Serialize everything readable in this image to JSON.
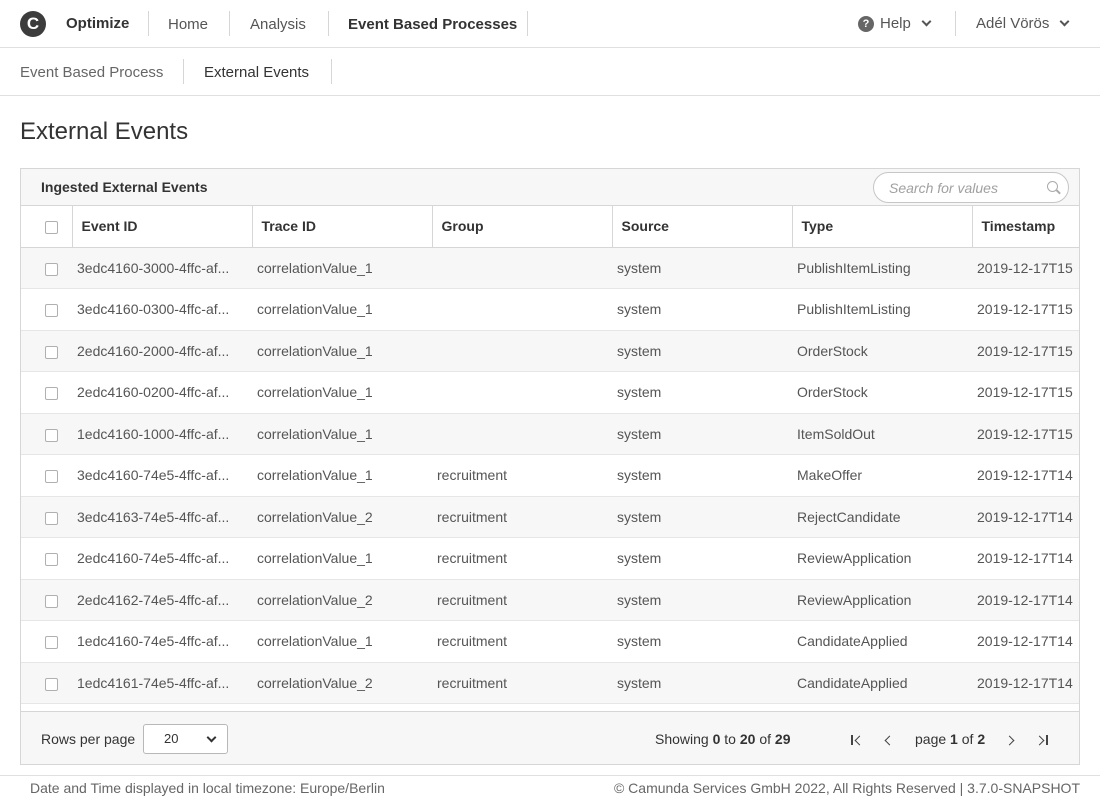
{
  "header": {
    "logo_letter": "C",
    "app_name": "Optimize",
    "nav": [
      "Home",
      "Analysis",
      "Event Based Processes"
    ],
    "help_label": "Help",
    "help_glyph": "?",
    "user_name": "Adél Vörös"
  },
  "subnav": [
    "Event Based Process",
    "External Events"
  ],
  "page_title": "External Events",
  "panel": {
    "title": "Ingested External Events",
    "search_placeholder": "Search for values"
  },
  "table": {
    "columns": [
      "Event ID",
      "Trace ID",
      "Group",
      "Source",
      "Type",
      "Timestamp"
    ],
    "rows": [
      [
        "3edc4160-3000-4ffc-af...",
        "correlationValue_1",
        "",
        "system",
        "PublishItemListing",
        "2019-12-17T15"
      ],
      [
        "3edc4160-0300-4ffc-af...",
        "correlationValue_1",
        "",
        "system",
        "PublishItemListing",
        "2019-12-17T15"
      ],
      [
        "2edc4160-2000-4ffc-af...",
        "correlationValue_1",
        "",
        "system",
        "OrderStock",
        "2019-12-17T15"
      ],
      [
        "2edc4160-0200-4ffc-af...",
        "correlationValue_1",
        "",
        "system",
        "OrderStock",
        "2019-12-17T15"
      ],
      [
        "1edc4160-1000-4ffc-af...",
        "correlationValue_1",
        "",
        "system",
        "ItemSoldOut",
        "2019-12-17T15"
      ],
      [
        "3edc4160-74e5-4ffc-af...",
        "correlationValue_1",
        "recruitment",
        "system",
        "MakeOffer",
        "2019-12-17T14"
      ],
      [
        "3edc4163-74e5-4ffc-af...",
        "correlationValue_2",
        "recruitment",
        "system",
        "RejectCandidate",
        "2019-12-17T14"
      ],
      [
        "2edc4160-74e5-4ffc-af...",
        "correlationValue_1",
        "recruitment",
        "system",
        "ReviewApplication",
        "2019-12-17T14"
      ],
      [
        "2edc4162-74e5-4ffc-af...",
        "correlationValue_2",
        "recruitment",
        "system",
        "ReviewApplication",
        "2019-12-17T14"
      ],
      [
        "1edc4160-74e5-4ffc-af...",
        "correlationValue_1",
        "recruitment",
        "system",
        "CandidateApplied",
        "2019-12-17T14"
      ],
      [
        "1edc4161-74e5-4ffc-af...",
        "correlationValue_2",
        "recruitment",
        "system",
        "CandidateApplied",
        "2019-12-17T14"
      ]
    ]
  },
  "pagination": {
    "rows_per_page_label": "Rows per page",
    "rows_per_page_value": "20",
    "showing_prefix": "Showing",
    "showing_from": "0",
    "showing_to_word": "to",
    "showing_to": "20",
    "showing_of_word": "of",
    "showing_total": "29",
    "page_word": "page",
    "page_current": "1",
    "page_of_word": "of",
    "page_total": "2"
  },
  "footer": {
    "timezone_note": "Date and Time displayed in local timezone: Europe/Berlin",
    "copyright": "© Camunda Services GmbH 2022, All Rights Reserved | 3.7.0-SNAPSHOT"
  }
}
